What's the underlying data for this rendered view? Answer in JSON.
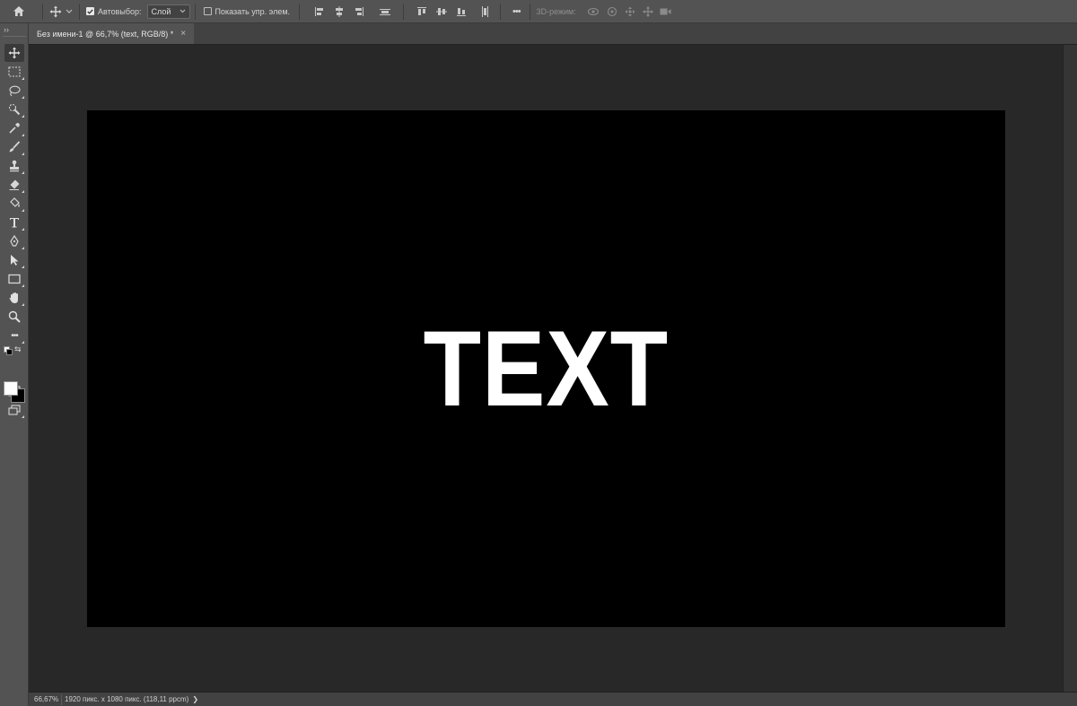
{
  "options_bar": {
    "auto_select_label": "Автовыбор:",
    "auto_select_checked": true,
    "layer_select_value": "Слой",
    "show_transform_label": "Показать упр. элем.",
    "show_transform_checked": false,
    "more_label": "•••",
    "mode_3d_label": "3D-режим:"
  },
  "document_tab": {
    "title": "Без имени-1 @ 66,7% (text, RGB/8) *",
    "close_glyph": "×"
  },
  "toolbar": {
    "collapse_glyph": "››",
    "more_tools_glyph": "•••",
    "swap_glyph": "⇆",
    "foreground_color": "#ffffff",
    "background_color": "#000000"
  },
  "canvas": {
    "text": "TEXT",
    "background_color": "#000000",
    "text_color": "#ffffff"
  },
  "status_bar": {
    "zoom": "66,67%",
    "doc_info": "1920 пикс. x 1080 пикс. (118,11 ppcm)",
    "arrow": "❯"
  }
}
